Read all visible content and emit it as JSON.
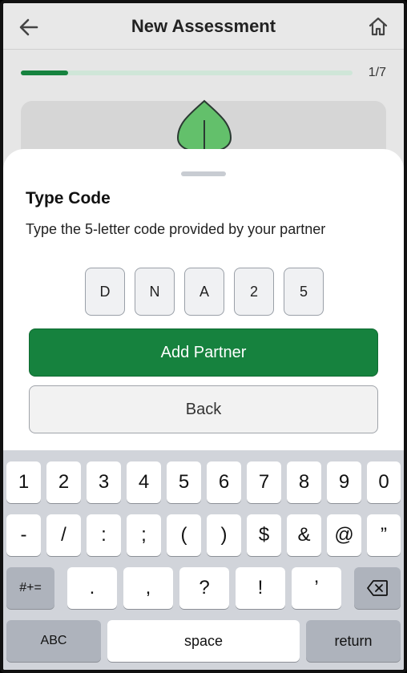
{
  "header": {
    "title": "New Assessment"
  },
  "progress": {
    "label": "1/7",
    "fraction": 0.143
  },
  "sheet": {
    "title": "Type Code",
    "subtitle": "Type the 5-letter code provided by your partner",
    "code": [
      "D",
      "N",
      "A",
      "2",
      "5"
    ],
    "primary_button": "Add Partner",
    "secondary_button": "Back"
  },
  "keyboard": {
    "row1": [
      "1",
      "2",
      "3",
      "4",
      "5",
      "6",
      "7",
      "8",
      "9",
      "0"
    ],
    "row2": [
      "-",
      "/",
      ":",
      ";",
      "(",
      ")",
      "$",
      "&",
      "@",
      "”"
    ],
    "row3": [
      "#+=",
      ".",
      ",",
      "?",
      "!",
      "’"
    ],
    "row4": {
      "abc": "ABC",
      "space": "space",
      "return": "return"
    }
  },
  "colors": {
    "accent": "#16823e",
    "progress_track": "#cfe6d8",
    "leaf": "#63c06b"
  },
  "icons": {
    "back": "arrow-left-icon",
    "home": "home-icon",
    "delete": "backspace-icon",
    "leaf": "leaf-icon"
  }
}
